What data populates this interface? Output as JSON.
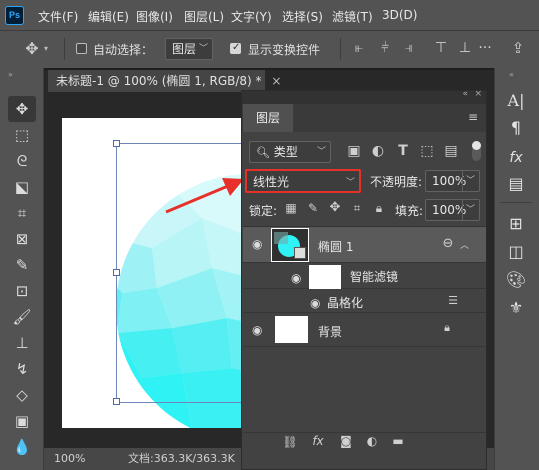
{
  "app": {
    "logo": "Ps"
  },
  "menu": [
    "文件(F)",
    "编辑(E)",
    "图像(I)",
    "图层(L)",
    "文字(Y)",
    "选择(S)",
    "滤镜(T)",
    "3D(D)"
  ],
  "options": {
    "auto_select_label": "自动选择：",
    "auto_select_checked": false,
    "target_value": "图层",
    "show_transform_label": "显示变换控件",
    "show_transform_checked": true
  },
  "document": {
    "tab_title": "未标题-1 @ 100% (椭圆 1, RGB/8) *",
    "tab_close": "×",
    "zoom": "100%",
    "doc_size": "文档:363.3K/363.3K"
  },
  "layers_panel": {
    "title": "图层",
    "filter_kind": "类型",
    "blend_mode": "线性光",
    "opacity_label": "不透明度:",
    "opacity_value": "100%",
    "lock_label": "锁定:",
    "fill_label": "填充:",
    "fill_value": "100%",
    "layers": [
      {
        "name": "椭圆 1",
        "visible": true,
        "selected": true
      },
      {
        "name": "智能滤镜",
        "visible": true
      },
      {
        "name": "晶格化",
        "visible": true
      },
      {
        "name": "背景",
        "visible": true,
        "locked": true
      }
    ]
  },
  "colors": {
    "annotation_red": "#e8302a",
    "shape_cyan": "#2ef2f4",
    "bbox_blue": "#6e86b8"
  }
}
